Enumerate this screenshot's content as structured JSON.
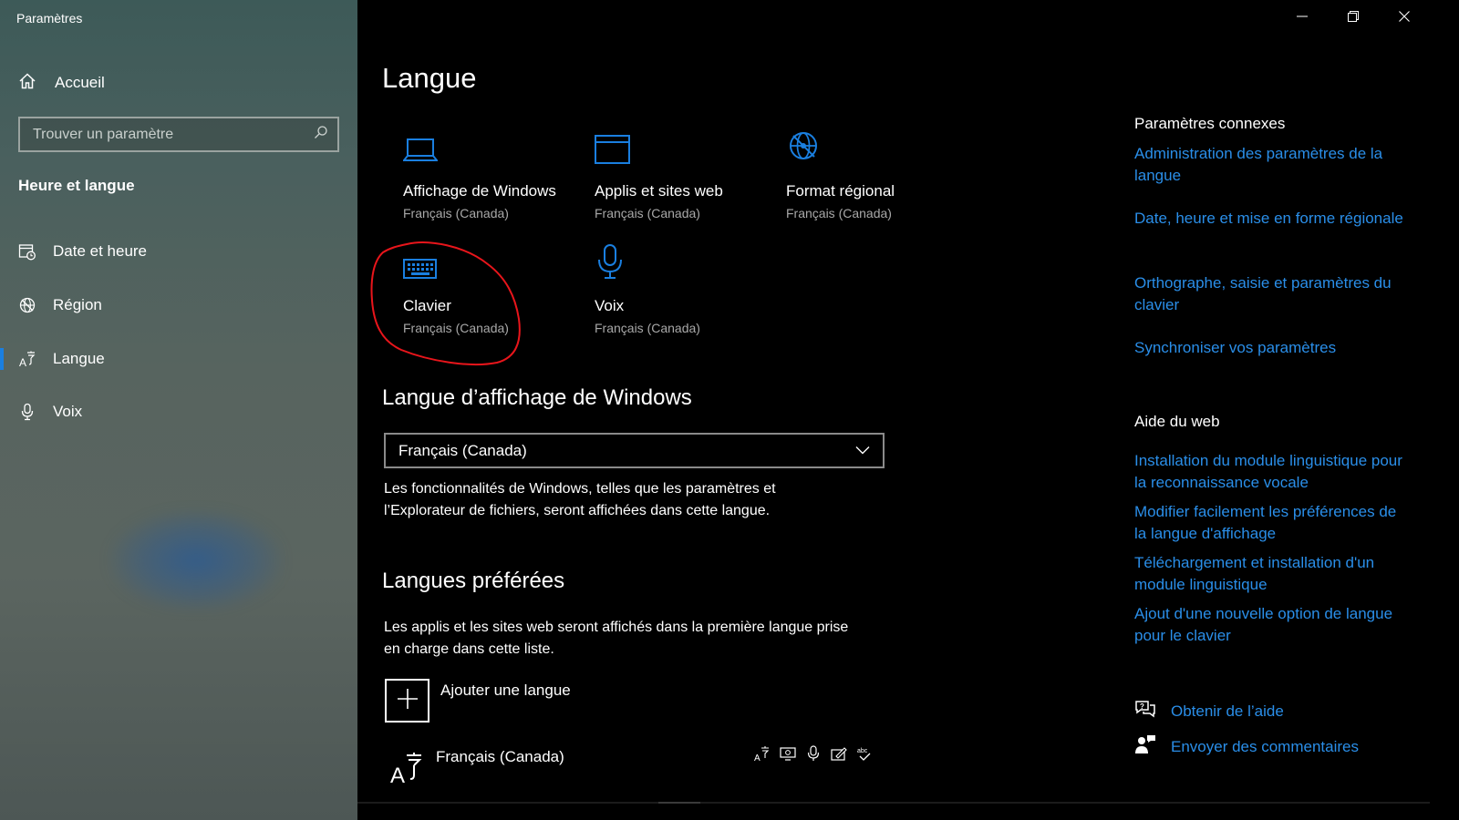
{
  "window": {
    "title": "Paramètres"
  },
  "sidebar": {
    "home_label": "Accueil",
    "search_placeholder": "Trouver un paramètre",
    "section_title": "Heure et langue",
    "items": [
      {
        "label": "Date et heure",
        "icon": "calendar-clock-icon"
      },
      {
        "label": "Région",
        "icon": "globe-icon"
      },
      {
        "label": "Langue",
        "icon": "language-icon",
        "active": true
      },
      {
        "label": "Voix",
        "icon": "microphone-icon"
      }
    ]
  },
  "main": {
    "title": "Langue",
    "tiles": [
      {
        "title": "Affichage de Windows",
        "subtitle": "Français (Canada)",
        "icon": "laptop-icon"
      },
      {
        "title": "Applis et sites web",
        "subtitle": "Français (Canada)",
        "icon": "window-icon"
      },
      {
        "title": "Format régional",
        "subtitle": "Français (Canada)",
        "icon": "globe-icon"
      },
      {
        "title": "Clavier",
        "subtitle": "Français (Canada)",
        "icon": "keyboard-icon"
      },
      {
        "title": "Voix",
        "subtitle": "Français (Canada)",
        "icon": "microphone-icon"
      }
    ],
    "display_language": {
      "heading": "Langue d’affichage de Windows",
      "selected": "Français (Canada)",
      "description_1": "Les fonctionnalités de Windows, telles que les paramètres et",
      "description_2": "l’Explorateur de fichiers, seront affichées dans cette langue."
    },
    "preferred": {
      "heading": "Langues préférées",
      "description_1": "Les applis et les sites web seront affichés dans la première langue prise",
      "description_2": "en charge dans cette liste.",
      "add_label": "Ajouter une langue",
      "language": "Français (Canada)"
    }
  },
  "related": {
    "heading": "Paramètres connexes",
    "links": [
      "Administration des paramètres de la langue",
      "Date, heure et mise en forme régionale",
      "Orthographe, saisie et paramètres du clavier",
      "Synchroniser vos paramètres"
    ]
  },
  "web_help": {
    "heading": "Aide du web",
    "links": [
      "Installation du module linguistique pour la reconnaissance vocale",
      "Modifier facilement les préférences de la langue d'affichage",
      "Téléchargement et installation d'un module linguistique",
      "Ajout d'une nouvelle option de langue pour le clavier"
    ]
  },
  "help": {
    "get_help": "Obtenir de l’aide",
    "feedback": "Envoyer des commentaires"
  },
  "colors": {
    "accent": "#2a8ee8",
    "annotation": "#e8151b"
  }
}
